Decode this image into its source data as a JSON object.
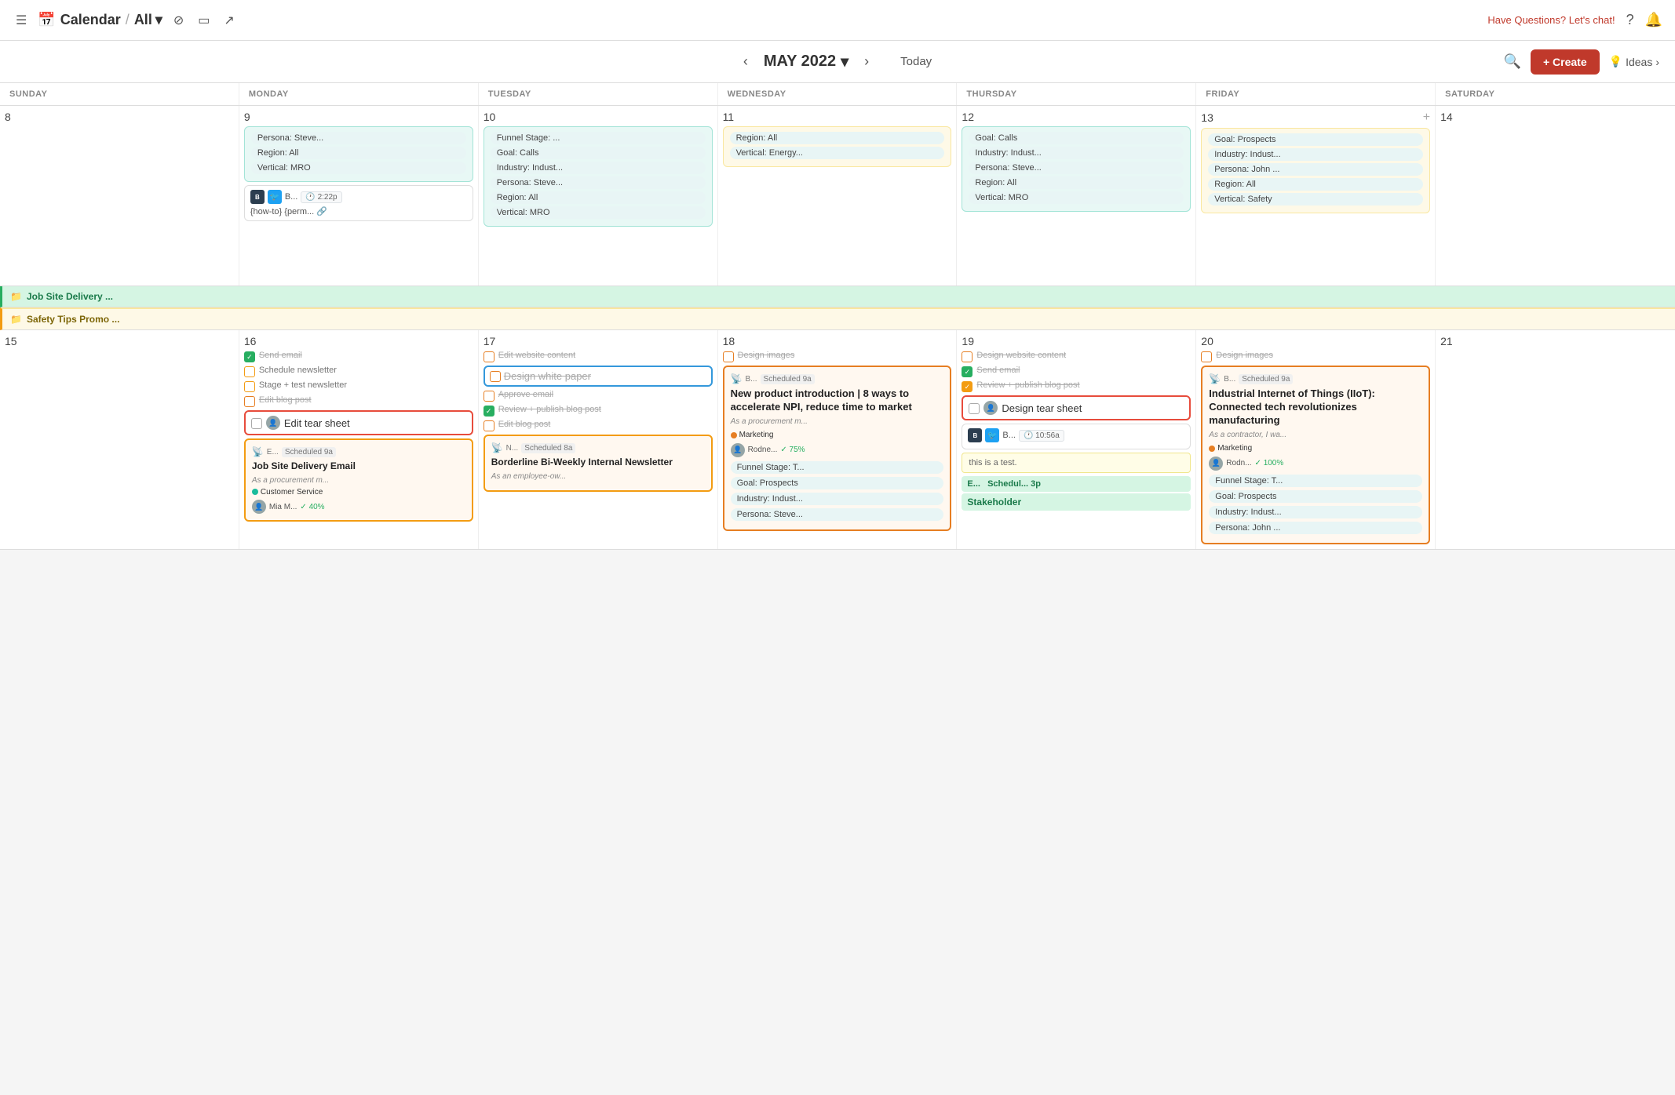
{
  "topNav": {
    "hamburger": "☰",
    "calIcon": "📅",
    "title": "Calendar",
    "slash": "/",
    "all": "All",
    "chevron": "▾",
    "filterIcon": "filter",
    "monitorIcon": "monitor",
    "shareIcon": "share",
    "haveQuestions": "Have Questions? Let's chat!",
    "helpIcon": "?",
    "bellIcon": "🔔"
  },
  "calHeader": {
    "prevIcon": "‹",
    "nextIcon": "›",
    "month": "MAY 2022",
    "chevron": "▾",
    "today": "Today",
    "searchIcon": "🔍",
    "createLabel": "+ Create",
    "bulbIcon": "💡",
    "ideasLabel": "Ideas",
    "ideasChevron": "›"
  },
  "dayHeaders": [
    "SUNDAY",
    "MONDAY",
    "TUESDAY",
    "WEDNESDAY",
    "THURSDAY",
    "FRIDAY",
    "SATURDAY"
  ],
  "week1": {
    "days": [
      8,
      9,
      10,
      11,
      12,
      13,
      14
    ],
    "mon": {
      "chips": [
        "Persona: Steve...",
        "Region: All",
        "Vertical: MRO"
      ],
      "socialTime": "2:22p",
      "permlink": "{how-to} {perm..."
    },
    "tue": {
      "chips": [
        "Funnel Stage: ...",
        "Goal: Calls",
        "Industry: Indust...",
        "Persona: Steve...",
        "Region: All",
        "Vertical: MRO"
      ]
    },
    "wed": {
      "chips": [
        "Region: All",
        "Vertical: Energy..."
      ]
    },
    "thu": {
      "chips": [
        "Goal: Calls",
        "Industry: Indust...",
        "Persona: Steve...",
        "Region: All",
        "Vertical: MRO"
      ]
    },
    "fri": {
      "dayNum": 13,
      "chips": [
        "Goal: Prospects",
        "Industry: Indust...",
        "Persona: John ...",
        "Region: All",
        "Vertical: Safety"
      ]
    }
  },
  "spanRows": {
    "jobSite": "Job Site Delivery ...",
    "safetyTips": "Safety Tips Promo ..."
  },
  "week2": {
    "days": [
      15,
      16,
      17,
      18,
      19,
      20,
      21
    ],
    "mon16": {
      "todos": [
        {
          "text": "Send email",
          "checked": true,
          "done": true
        },
        {
          "text": "Schedule newsletter",
          "checked": false,
          "yellowBorder": true
        },
        {
          "text": "Stage + test newsletter",
          "checked": false,
          "yellowBorder": true
        },
        {
          "text": "Edit blog post",
          "checked": false,
          "orangeBorder": true,
          "strikethrough": true
        }
      ],
      "tearSheet": {
        "label": "Edit tear sheet",
        "pinkBorder": true
      },
      "newsletter": {
        "rss": true,
        "label": "E...",
        "scheduledLabel": "Scheduled 9a",
        "title": "Job Site Delivery Email",
        "desc": "As a procurement m...",
        "tag": "Customer Service",
        "tagColor": "teal",
        "author": "Mia M...",
        "progress": "40%"
      }
    },
    "tue17": {
      "todos": [
        {
          "text": "Edit website content",
          "checked": false,
          "strikethrough": true
        },
        {
          "text": "Design white paper",
          "checked": false,
          "strikethrough": true,
          "blueBorder": true
        },
        {
          "text": "Approve email",
          "checked": false,
          "strikethrough": true
        },
        {
          "text": "Review + publish blog post",
          "checked": true
        },
        {
          "text": "Edit blog post",
          "checked": false,
          "strikethrough": true
        }
      ],
      "newsletter": {
        "rss": true,
        "label": "N...",
        "scheduledLabel": "Scheduled 8a",
        "title": "Borderline Bi-Weekly Internal Newsletter",
        "desc": "As an employee-ow..."
      }
    },
    "wed18": {
      "todos": [
        {
          "text": "Design images",
          "checked": false,
          "strikethrough": true
        }
      ],
      "newsletter": {
        "rss": true,
        "label": "B...",
        "scheduledLabel": "Scheduled 9a",
        "title": "New product introduction | 8 ways to accelerate NPI, reduce time to market",
        "desc": "As a procurement m...",
        "tag": "Marketing",
        "tagColor": "orange",
        "author": "Rodne...",
        "progress": "75%",
        "chips": [
          "Funnel Stage: T...",
          "Goal: Prospects",
          "Industry: Indust...",
          "Persona: Steve..."
        ]
      }
    },
    "thu19": {
      "todos": [
        {
          "text": "Design website content",
          "checked": false,
          "strikethrough": true
        },
        {
          "text": "Send email",
          "checked": true,
          "done": true
        },
        {
          "text": "Review + publish blog post",
          "checked": true,
          "done": true
        }
      ],
      "tearSheet": {
        "label": "Design tear sheet",
        "pinkBorder": true
      },
      "socialRow": {
        "time": "10:56a"
      },
      "testNote": "this is a test.",
      "stakeholderLabel": "Stakeholder"
    },
    "fri20": {
      "todos": [
        {
          "text": "Design images",
          "checked": false,
          "strikethrough": true
        }
      ],
      "newsletter": {
        "rss": true,
        "label": "B...",
        "scheduledLabel": "Scheduled 9a",
        "title": "Industrial Internet of Things (IIoT): Connected tech revolutionizes manufacturing",
        "desc": "As a contractor, I wa...",
        "tag": "Marketing",
        "tagColor": "orange",
        "author": "Rodn...",
        "progress": "100%",
        "chips": [
          "Funnel Stage: T...",
          "Goal: Prospects",
          "Industry: Indust...",
          "Persona: John ..."
        ]
      }
    }
  }
}
